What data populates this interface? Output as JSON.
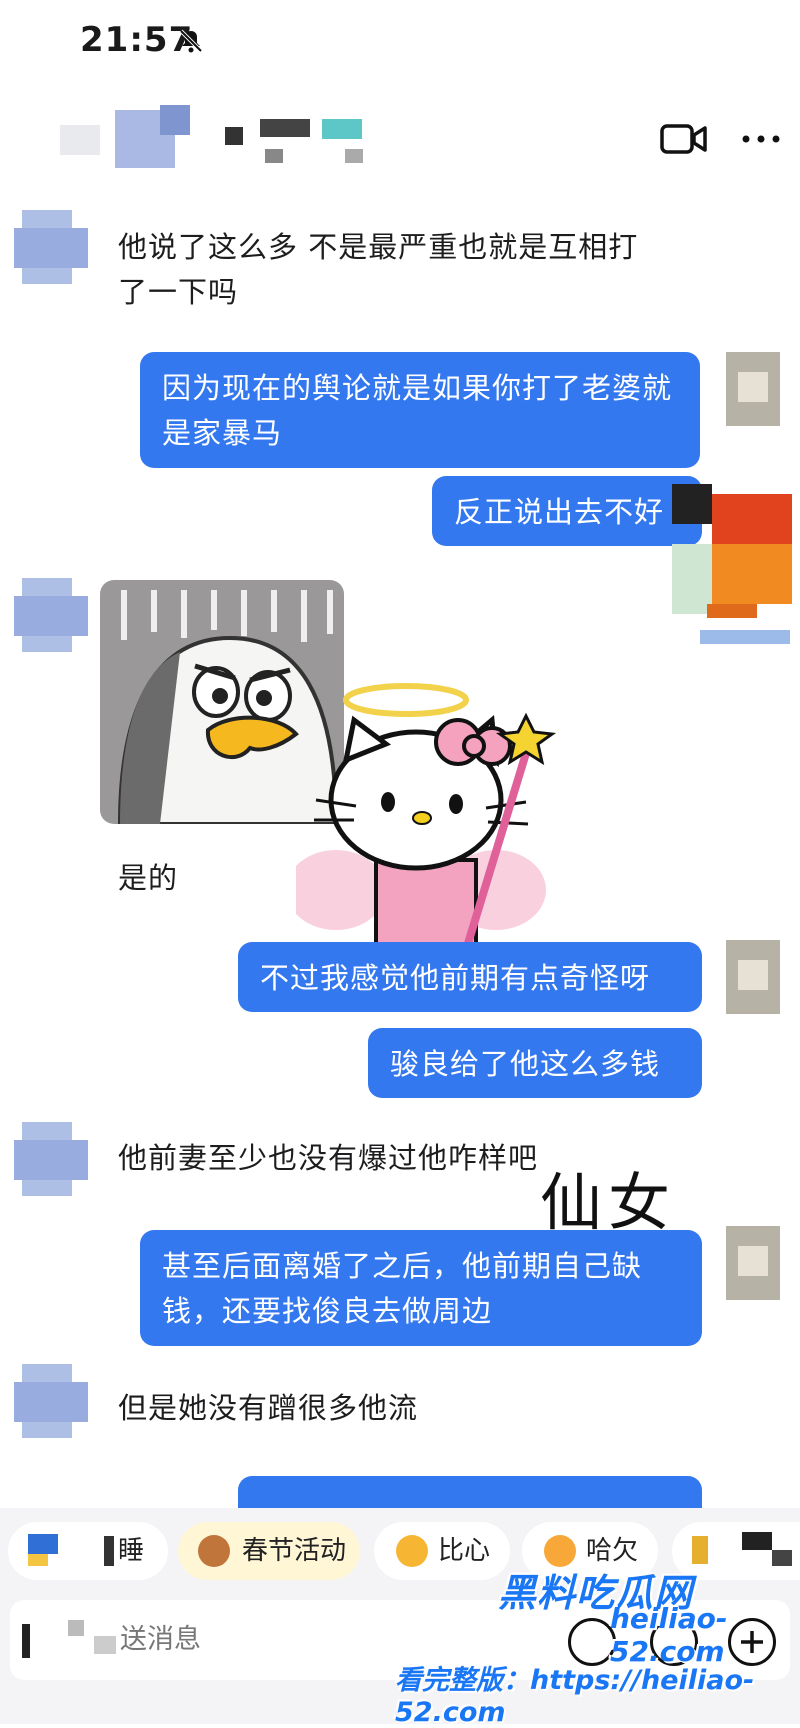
{
  "status_bar": {
    "time": "21:57"
  },
  "header": {
    "contact_name_hidden": true
  },
  "messages": [
    {
      "from": "other",
      "text": "他说了这么多 不是最严重也就是互相打了一下吗"
    },
    {
      "from": "me",
      "text": "因为现在的舆论就是如果你打了老婆就是家暴马"
    },
    {
      "from": "me",
      "text": "反正说出去不好"
    },
    {
      "from": "other",
      "text": "是的",
      "sticker": "angry-duck-sticker"
    },
    {
      "from": "me",
      "text": "不过我感觉他前期有点奇怪呀"
    },
    {
      "from": "me",
      "text": "骏良给了他这么多钱"
    },
    {
      "from": "other",
      "text": "他前妻至少也没有爆过他咋样吧"
    },
    {
      "from": "me",
      "text": "甚至后面离婚了之后，他前期自己缺钱，还要找俊良去做周边"
    },
    {
      "from": "other",
      "text": "但是她没有蹭很多他流"
    }
  ],
  "overlay_text": "仙女",
  "quick_actions": [
    {
      "label": "睡"
    },
    {
      "label": "春节活动"
    },
    {
      "label": "比心"
    },
    {
      "label": "哈欠"
    }
  ],
  "input": {
    "placeholder": "送消息"
  },
  "watermark": {
    "logo": "黑料吃瓜网",
    "site": "heiliao-52.com",
    "url": "看完整版：https://heiliao-52.com"
  },
  "colors": {
    "accent": "#3478f0",
    "watermark": "#1977f5"
  }
}
